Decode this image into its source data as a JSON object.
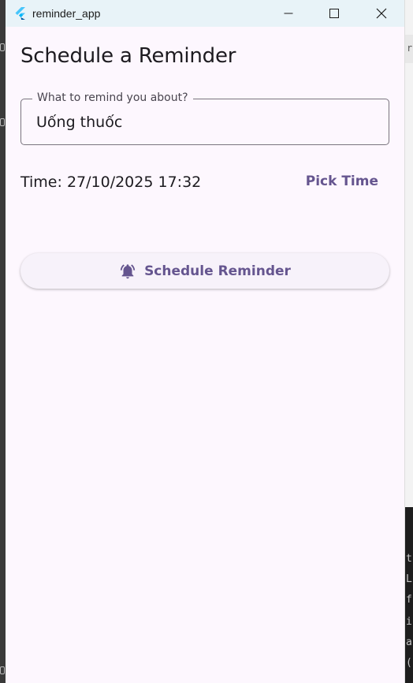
{
  "window": {
    "title": "reminder_app",
    "controls": {
      "minimize": "—",
      "maximize": "☐",
      "close": "✕"
    }
  },
  "page": {
    "heading": "Schedule a Reminder"
  },
  "reminder_field": {
    "label": "What to remind you about?",
    "value": "Uống thuốc"
  },
  "time": {
    "display": "Time: 27/10/2025 17:32",
    "pick_label": "Pick Time"
  },
  "schedule_button": {
    "label": "Schedule Reminder",
    "icon": "alarm-bell-icon"
  },
  "background_editor": {
    "tab_fragment": "rt",
    "code_fragments": [
      "t",
      "L",
      "f",
      "i",
      "a",
      "("
    ]
  },
  "colors": {
    "accent": "#65558f",
    "surface": "#fdf7fe",
    "titlebar": "#e8f3f8",
    "outline": "#79747e"
  }
}
